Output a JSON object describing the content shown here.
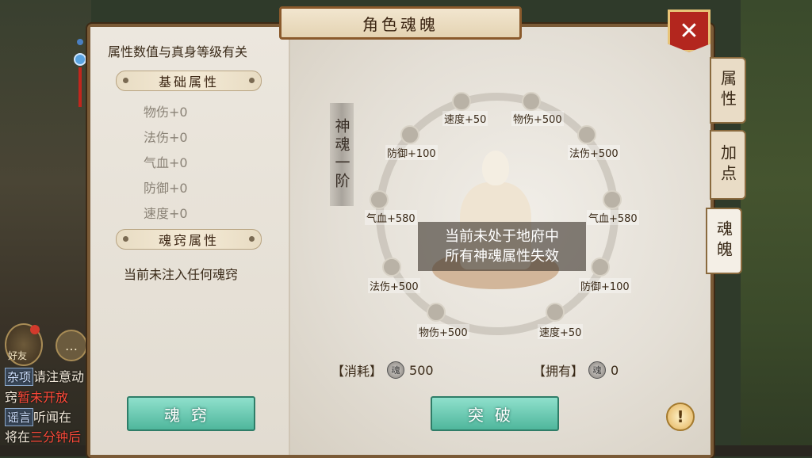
{
  "window": {
    "title": "角色魂魄",
    "close_icon": "close-icon"
  },
  "left_panel": {
    "description": "属性数值与真身等级有关",
    "basic_header": "基础属性",
    "basic_stats": [
      "物伤+0",
      "法伤+0",
      "气血+0",
      "防御+0",
      "速度+0"
    ],
    "soul_header": "魂窍属性",
    "soul_empty_text": "当前未注入任何魂窍",
    "soul_button": "魂窍"
  },
  "main": {
    "stage_title": "神魂一阶",
    "overlay_line1": "当前未处于地府中",
    "overlay_line2": "所有神魂属性失效",
    "nodes": {
      "top_left": "速度+50",
      "top_right": "物伤+500",
      "upper_left": "防御+100",
      "upper_right": "法伤+500",
      "mid_left": "气血+580",
      "mid_right": "气血+580",
      "lower_left": "法伤+500",
      "lower_right": "防御+100",
      "bottom_left": "物伤+500",
      "bottom_right": "速度+50"
    },
    "cost_label": "【消耗】",
    "cost_value": "500",
    "own_label": "【拥有】",
    "own_value": "0",
    "breakthrough_button": "突破"
  },
  "tabs": [
    {
      "label": "属性",
      "active": false
    },
    {
      "label": "加点",
      "active": false
    },
    {
      "label": "魂魄",
      "active": true
    }
  ],
  "chat": {
    "friend_label": "好友",
    "line1_tag": "杂项",
    "line1_text": "请注意动",
    "line2_prefix": "窍",
    "line2_red": "暂未开放",
    "line3_tag": "谣言",
    "line3_text": "听闻在",
    "line4_prefix": "将在",
    "line4_red": "三分钟后"
  },
  "colors": {
    "accent_green": "#4fb69c",
    "close_red": "#b3261e",
    "frame_brown": "#7a5a36"
  }
}
